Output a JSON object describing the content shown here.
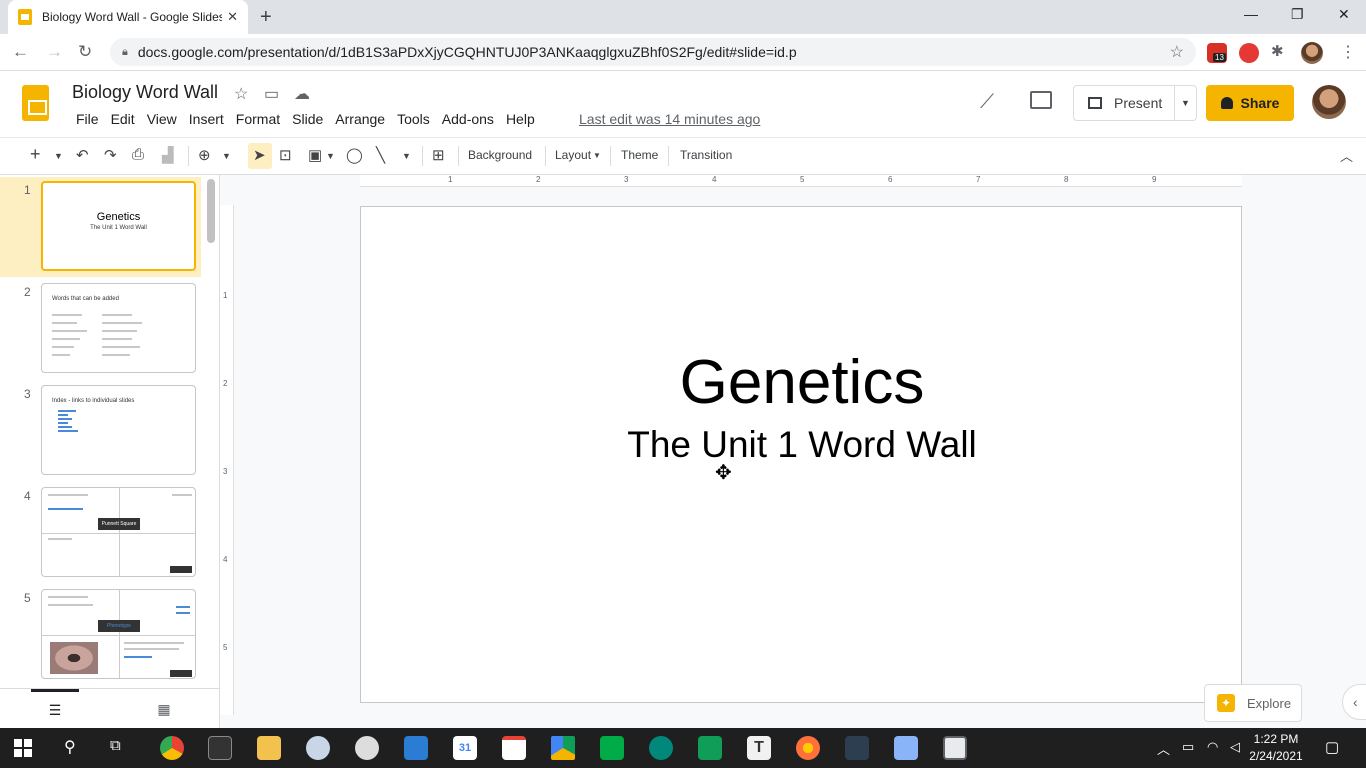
{
  "browser": {
    "tab_title": "Biology Word Wall - Google Slides",
    "tab_close": "✕",
    "new_tab": "+",
    "url": "docs.google.com/presentation/d/1dB1S3aPDxXjyCGQHNTUJ0P3ANKaaqglgxuZBhf0S2Fg/edit#slide=id.p",
    "extension_badge": "13"
  },
  "header": {
    "doc_title": "Biology Word Wall",
    "menus": [
      "File",
      "Edit",
      "View",
      "Insert",
      "Format",
      "Slide",
      "Arrange",
      "Tools",
      "Add-ons",
      "Help"
    ],
    "last_edit": "Last edit was 14 minutes ago",
    "present_label": "Present",
    "share_label": "Share"
  },
  "toolbar": {
    "background": "Background",
    "layout": "Layout",
    "theme": "Theme",
    "transition": "Transition"
  },
  "filmstrip": {
    "slides": [
      {
        "num": "1",
        "title": "Genetics",
        "subtitle": "The Unit 1 Word Wall"
      },
      {
        "num": "2",
        "title": "Words that can be added"
      },
      {
        "num": "3",
        "title": "Index - links to individual slides"
      },
      {
        "num": "4",
        "title": "Punnett Square"
      },
      {
        "num": "5",
        "title": "Phenotype"
      }
    ]
  },
  "ruler": {
    "h_marks": [
      "1",
      "2",
      "3",
      "4",
      "5",
      "6",
      "7",
      "8",
      "9"
    ],
    "v_marks": [
      "1",
      "2",
      "3",
      "4",
      "5"
    ]
  },
  "slide": {
    "title": "Genetics",
    "subtitle": "The Unit 1 Word Wall"
  },
  "explore_label": "Explore",
  "taskbar": {
    "time": "1:22 PM",
    "date": "2/24/2021",
    "calendar_day": "31"
  },
  "colors": {
    "slides_yellow": "#f4b400",
    "selection_bg": "#feefc3",
    "taskbar": "#1f1f1f"
  }
}
